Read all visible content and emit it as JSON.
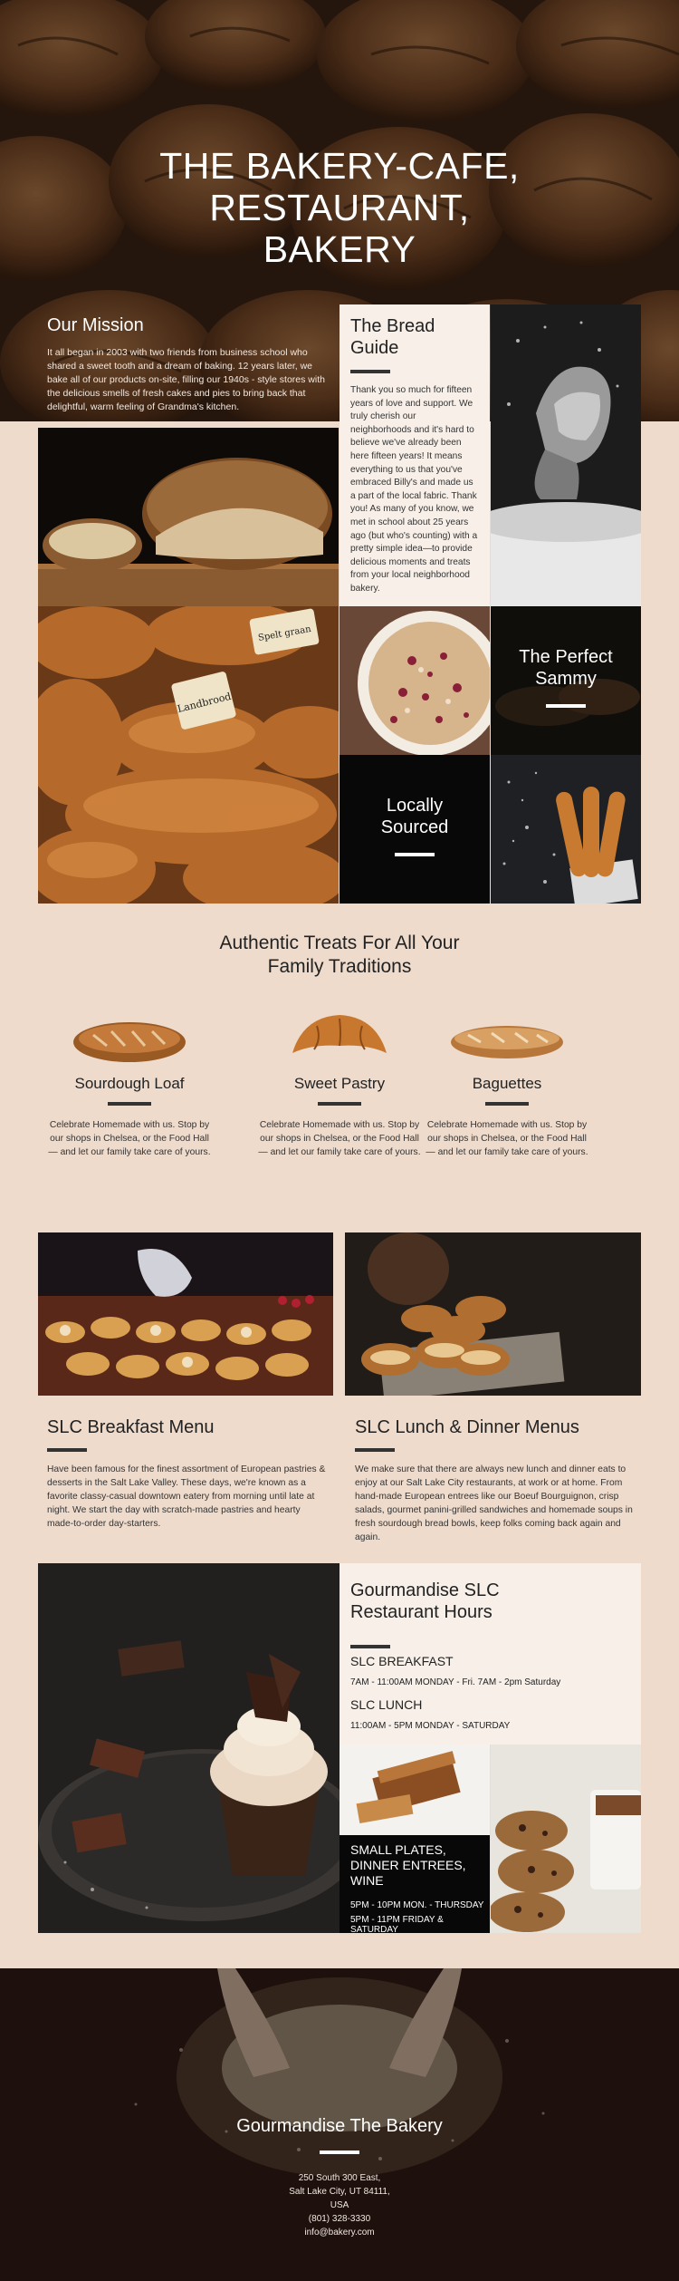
{
  "hero": {
    "title_lines": [
      "THE BAKERY-CAFE,",
      "RESTAURANT,",
      "BAKERY"
    ],
    "mission_title": "Our Mission",
    "mission_text": "It all began in 2003 with two friends from business school who shared a sweet tooth and a dream of baking. 12 years later, we bake all of our products on-site, filling our 1940s - style stores with the delicious smells of fresh cakes and pies to bring back that delightful, warm feeling of Grandma's kitchen."
  },
  "guide": {
    "title_lines": [
      "The Bread",
      "Guide"
    ],
    "text": "Thank you so much for fifteen years of love and support. We truly cherish our neighborhoods and it's hard to believe we've already been here fifteen years! It means everything to us that you've embraced Billy's and made us a part of the local fabric. Thank you! As many of you know, we met in school about 25 years ago (but who's counting) with a pretty simple idea—to provide delicious moments and treats from your local neighborhood bakery."
  },
  "tiles": {
    "perfect_lines": [
      "The Perfect",
      "Sammy"
    ],
    "local_lines": [
      "Locally",
      "Sourced"
    ]
  },
  "photos": {
    "loaf_tag": "Landbrood",
    "spelt_tag": "Spelt graan"
  },
  "treats": {
    "title_lines": [
      "Authentic Treats For All Your",
      "Family Traditions"
    ],
    "items": [
      {
        "name": "Sourdough Loaf",
        "desc": "Celebrate Homemade with us. Stop by our shops in Chelsea, or the Food Hall — and let our family take care of yours."
      },
      {
        "name": "Sweet Pastry",
        "desc": "Celebrate Homemade with us. Stop by our shops in Chelsea, or the Food Hall — and let our family take care of yours."
      },
      {
        "name": "Baguettes",
        "desc": "Celebrate Homemade with us. Stop by our shops in Chelsea, or the Food Hall — and let our family take care of yours."
      }
    ]
  },
  "menus": {
    "breakfast": {
      "title": "SLC Breakfast Menu",
      "text": "Have been famous for the finest assortment of European pastries & desserts in the Salt Lake Valley.  These days, we're known as a favorite classy-casual downtown eatery from morning until late at night.  We start the day with scratch-made pastries and hearty made-to-order day-starters."
    },
    "lunch": {
      "title": "SLC Lunch & Dinner Menus",
      "text": "We make sure that there are always new lunch and dinner eats to enjoy at our Salt Lake City restaurants, at work or at home. From hand-made European entrees like our Boeuf Bourguignon, crisp salads, gourmet panini-grilled sandwiches and homemade soups in fresh sourdough bread bowls, keep folks coming back again and again."
    }
  },
  "hours": {
    "title_lines": [
      "Gourmandise SLC",
      "Restaurant Hours"
    ],
    "breakfast_label": "SLC BREAKFAST",
    "breakfast_hours": "7AM - 11:00AM MONDAY - Fri.  7AM - 2pm Saturday",
    "lunch_label": "SLC LUNCH",
    "lunch_hours": "11:00AM - 5PM MONDAY - SATURDAY",
    "plates_lines": [
      "SMALL PLATES,",
      "DINNER ENTREES,",
      "WINE"
    ],
    "plates_hours_1": "5PM - 10PM MON. - THURSDAY",
    "plates_hours_2": "5PM - 11PM FRIDAY & SATURDAY"
  },
  "footer": {
    "title": "Gourmandise The Bakery",
    "address_1": "250 South 300 East,",
    "address_2": "Salt Lake City, UT 84111,",
    "address_3": "USA",
    "phone": "(801) 328-3330",
    "email": "info@bakery.com"
  },
  "colors": {
    "page_bg": "#eedbcc",
    "card_bg": "#f7efe8",
    "tile_dark": "#080808",
    "text_dark": "#222222",
    "accent_bar": "#333333"
  }
}
